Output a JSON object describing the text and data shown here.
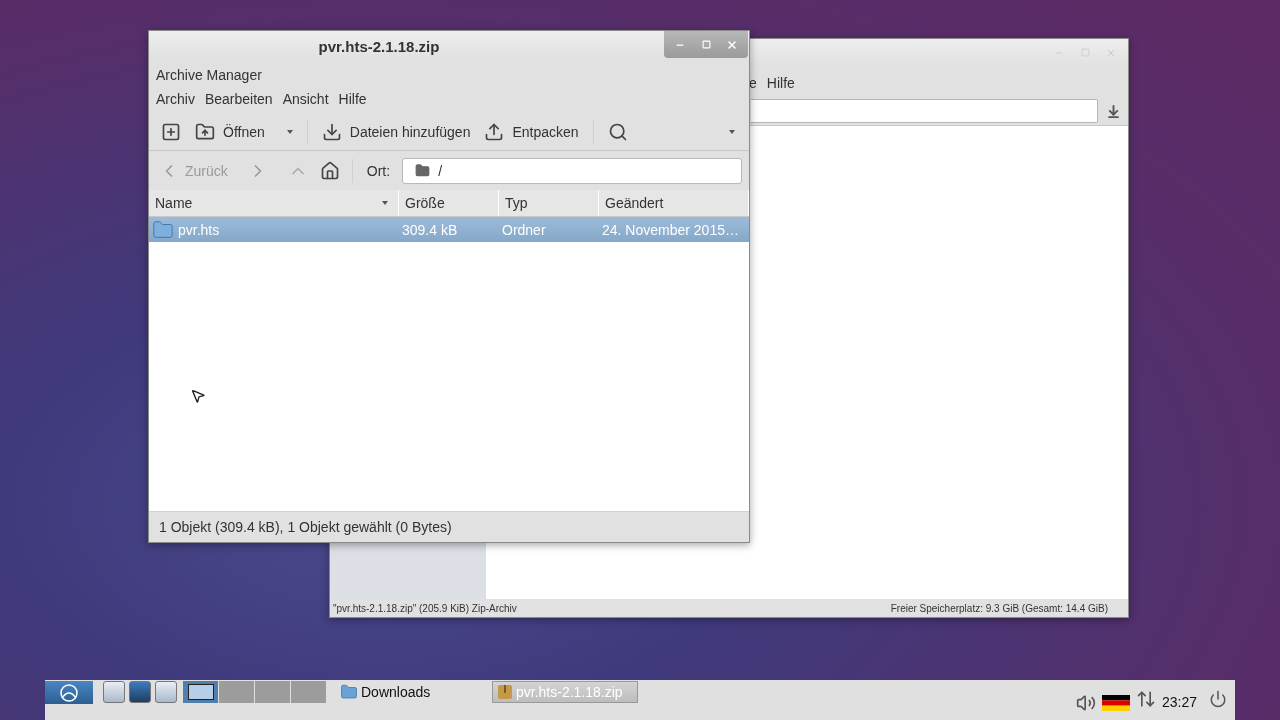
{
  "back_window": {
    "menu_partial": "e",
    "menu": [
      "Hilfe"
    ],
    "status_left": "\"pvr.hts-2.1.18.zip\" (205.9 KiB) Zip-Archiv",
    "status_right": "Freier Speicherplatz: 9.3 GiB (Gesamt: 14.4 GiB)"
  },
  "window": {
    "title": "pvr.hts-2.1.18.zip",
    "app_name": "Archive Manager",
    "menu": [
      "Archiv",
      "Bearbeiten",
      "Ansicht",
      "Hilfe"
    ],
    "toolbar": [
      {
        "kind": "new"
      },
      {
        "kind": "open",
        "label": "Öffnen"
      },
      {
        "kind": "add",
        "label": "Dateien hinzufügen"
      },
      {
        "kind": "extract",
        "label": "Entpacken"
      },
      {
        "kind": "search"
      }
    ],
    "nav": {
      "back": {
        "label": "Zurück",
        "disabled": true
      },
      "location_label": "Ort:",
      "location": "/"
    },
    "columns": [
      {
        "label": "Name",
        "sorted": true
      },
      {
        "label": "Größe",
        "sorted": false
      },
      {
        "label": "Typ",
        "sorted": false
      },
      {
        "label": "Geändert",
        "sorted": false
      }
    ],
    "rows": [
      {
        "name": "pvr.hts",
        "size": "309.4 kB",
        "type": "Ordner",
        "modified": "24. November 2015…",
        "selected": true
      }
    ],
    "status": "1 Objekt (309.4 kB), 1 Objekt gewählt (0 Bytes)"
  },
  "taskbar": {
    "workspaces": [
      {
        "selected": true
      },
      {
        "selected": false
      },
      {
        "selected": false
      },
      {
        "selected": false
      }
    ],
    "tasks": [
      {
        "label": "Downloads",
        "kind": "folder",
        "selected": false
      },
      {
        "label": "pvr.hts-2.1.18.zip",
        "kind": "archive",
        "selected": true
      }
    ],
    "clock": "23:27"
  }
}
